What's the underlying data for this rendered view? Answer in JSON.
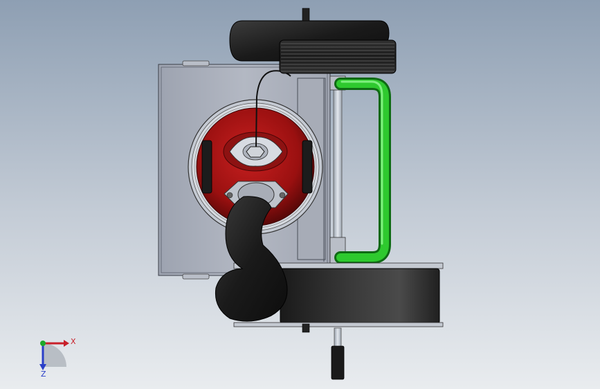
{
  "view": {
    "type": "cad-3d-model-viewport",
    "background_top": "#8e9fb3",
    "background_bottom": "#e9ecef"
  },
  "model": {
    "parts": [
      "mounting-plate",
      "rotor-housing",
      "rotor",
      "upper-hose",
      "lower-hose",
      "finned-coil",
      "green-coolant-pipe",
      "sight-tube",
      "base-drum",
      "bottom-drain"
    ],
    "colors": {
      "rotor": "#a31515",
      "coolant_pipe": "#22b526",
      "plate": "#a9aeb9",
      "hose": "#1e1e1e"
    }
  },
  "triad": {
    "x_label": "X",
    "z_label": "Z",
    "x_color": "#c8202a",
    "z_color": "#2a3fc8",
    "y_color": "#1ea82a"
  }
}
